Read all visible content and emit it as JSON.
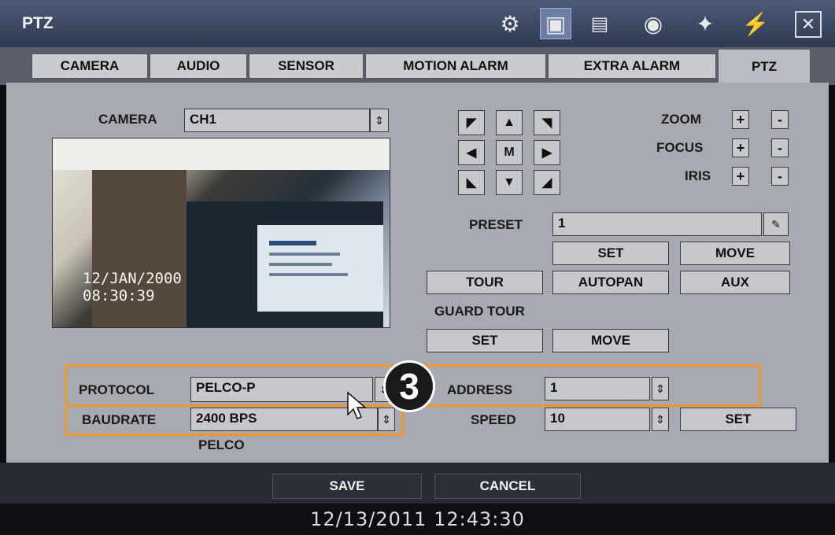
{
  "window": {
    "title": "PTZ",
    "icons": [
      "settings-gear-icon",
      "camera-icon",
      "record-schedule-icon",
      "network-globe-icon",
      "event-icon",
      "system-icon",
      "close-icon"
    ]
  },
  "tabs": [
    {
      "label": "CAMERA"
    },
    {
      "label": "AUDIO"
    },
    {
      "label": "SENSOR"
    },
    {
      "label": "MOTION ALARM"
    },
    {
      "label": "EXTRA ALARM"
    },
    {
      "label": "PTZ",
      "active": true
    }
  ],
  "camera": {
    "label": "CAMERA",
    "value": "CH1",
    "preview_overlay": {
      "date": "12/JAN/2000",
      "time": "08:30:39"
    }
  },
  "ptz_pad": {
    "center_label": "M"
  },
  "lens": {
    "zoom_label": "ZOOM",
    "focus_label": "FOCUS",
    "iris_label": "IRIS",
    "plus": "+",
    "minus": "-"
  },
  "preset": {
    "label": "PRESET",
    "value": "1",
    "set_label": "SET",
    "move_label": "MOVE"
  },
  "functions": {
    "tour_label": "TOUR",
    "autopan_label": "AUTOPAN",
    "aux_label": "AUX"
  },
  "guard_tour": {
    "label": "GUARD TOUR",
    "set_label": "SET",
    "move_label": "MOVE"
  },
  "protocol": {
    "label": "PROTOCOL",
    "value": "PELCO-P"
  },
  "address": {
    "label": "ADDRESS",
    "value": "1"
  },
  "baudrate": {
    "label": "BAUDRATE",
    "value": "2400 BPS",
    "note": "PELCO"
  },
  "speed": {
    "label": "SPEED",
    "value": "10",
    "set_label": "SET"
  },
  "callout": {
    "number": "3",
    "highlight_color": "#f0962c"
  },
  "footer": {
    "save_label": "SAVE",
    "cancel_label": "CANCEL"
  },
  "status": {
    "datetime": "12/13/2011 12:43:30"
  }
}
